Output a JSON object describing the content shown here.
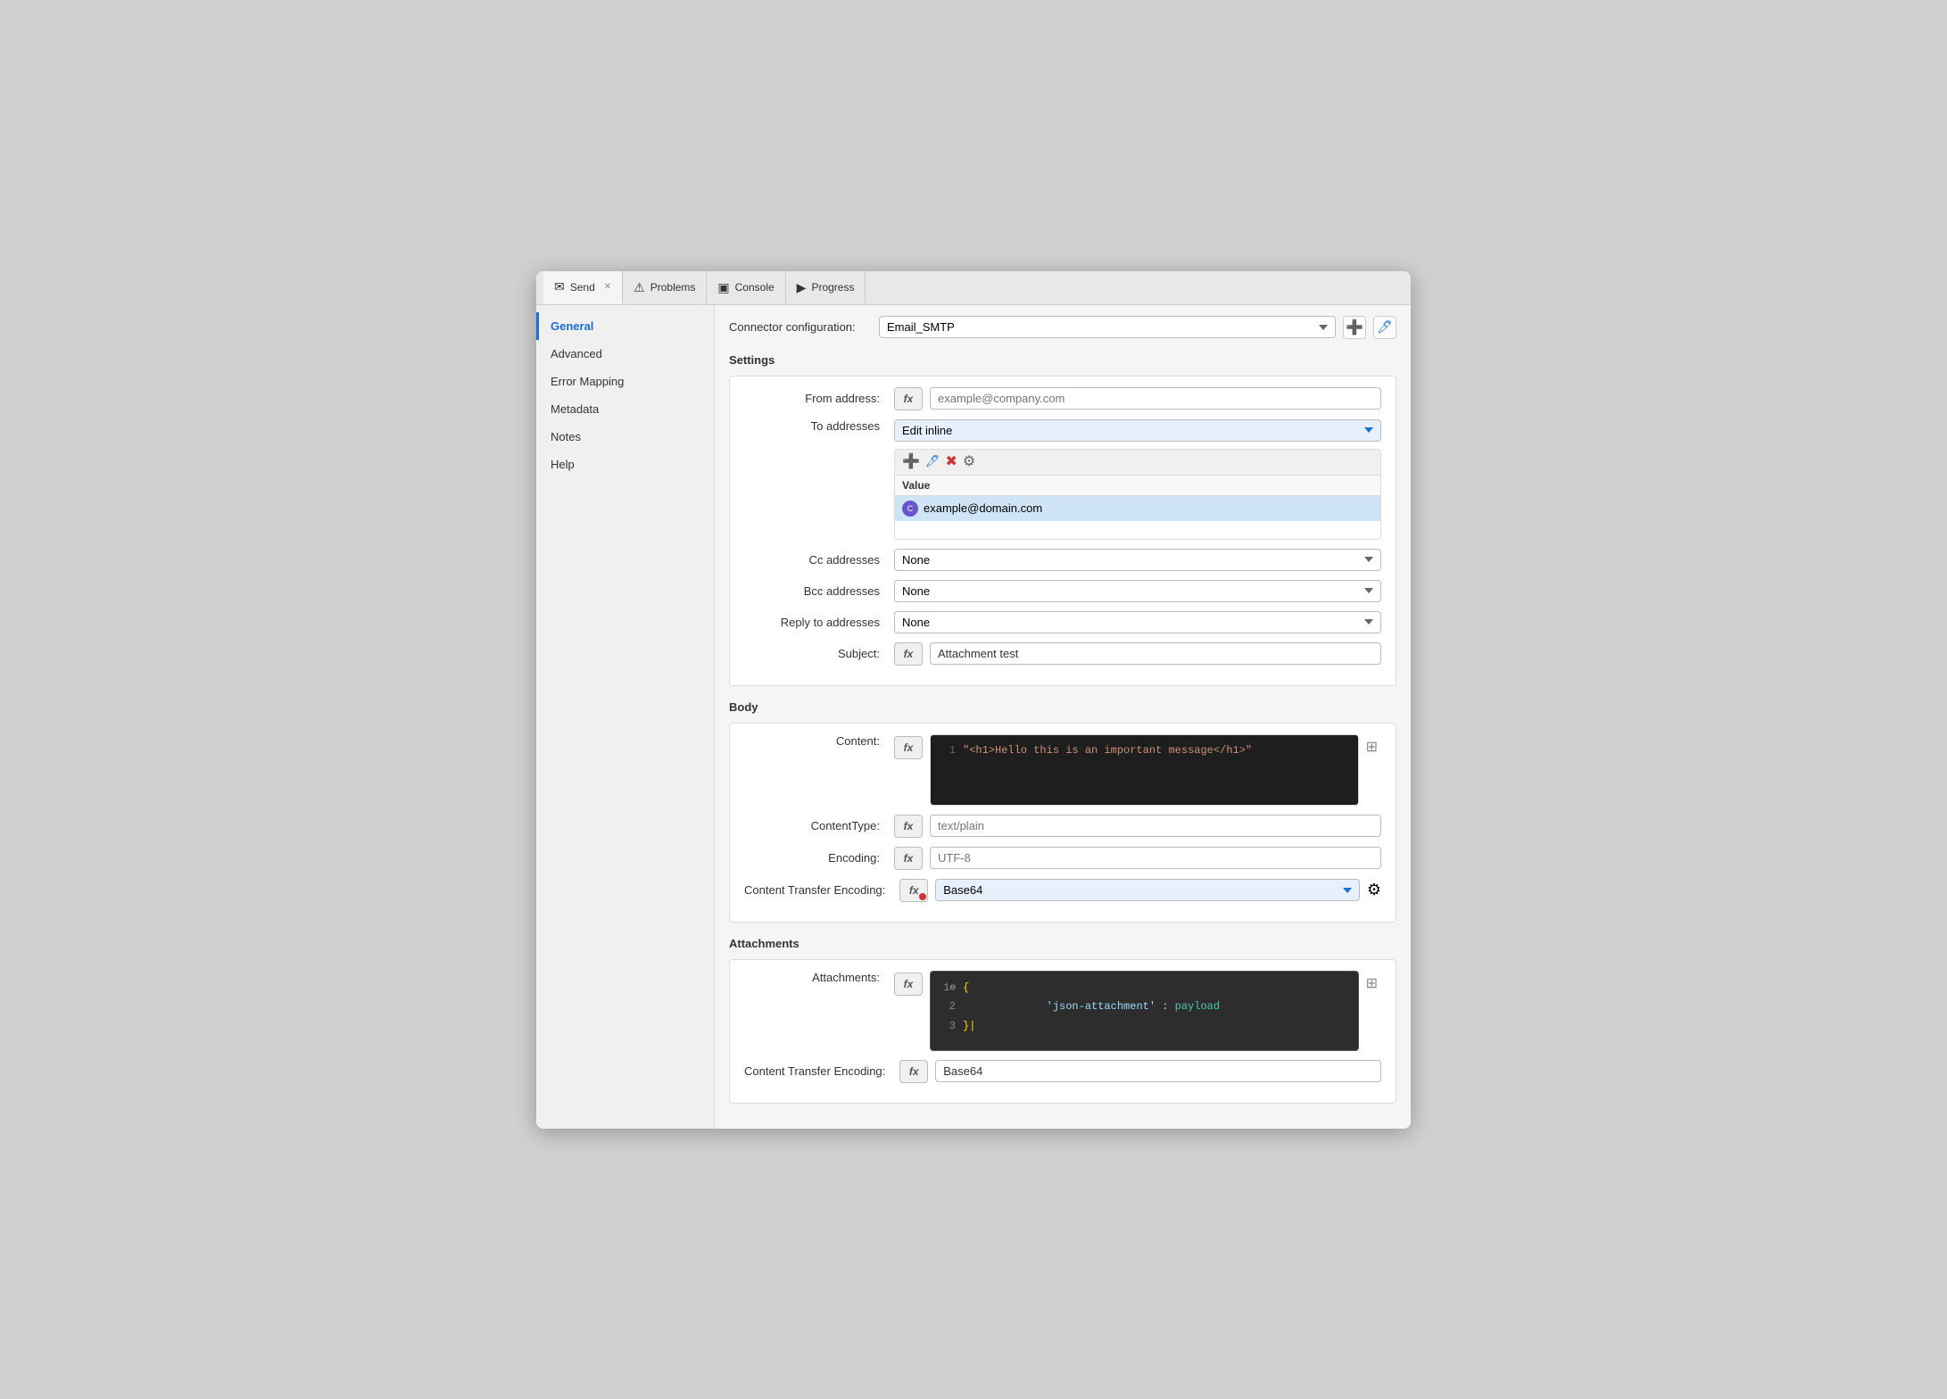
{
  "window": {
    "title": "Send"
  },
  "tabs": [
    {
      "id": "send",
      "label": "Send",
      "icon": "✉",
      "active": true,
      "closable": true
    },
    {
      "id": "problems",
      "label": "Problems",
      "icon": "⚠",
      "active": false,
      "closable": false
    },
    {
      "id": "console",
      "label": "Console",
      "icon": "▣",
      "active": false,
      "closable": false
    },
    {
      "id": "progress",
      "label": "Progress",
      "icon": "▶",
      "active": false,
      "closable": false
    }
  ],
  "sidebar": {
    "items": [
      {
        "id": "general",
        "label": "General",
        "active": true
      },
      {
        "id": "advanced",
        "label": "Advanced",
        "active": false
      },
      {
        "id": "error-mapping",
        "label": "Error Mapping",
        "active": false
      },
      {
        "id": "metadata",
        "label": "Metadata",
        "active": false
      },
      {
        "id": "notes",
        "label": "Notes",
        "active": false
      },
      {
        "id": "help",
        "label": "Help",
        "active": false
      }
    ]
  },
  "content": {
    "connector_config_label": "Connector configuration:",
    "connector_config_value": "Email_SMTP",
    "settings_section": "Settings",
    "from_address_label": "From address:",
    "from_address_placeholder": "example@company.com",
    "to_addresses_label": "To addresses",
    "to_addresses_value": "Edit inline",
    "toolbar": {
      "add": "➕",
      "edit": "🖊",
      "delete": "✖",
      "settings": "⚙"
    },
    "table_header": "Value",
    "email_entry": "example@domain.com",
    "cc_label": "Cc addresses",
    "cc_value": "None",
    "bcc_label": "Bcc addresses",
    "bcc_value": "None",
    "reply_to_label": "Reply to addresses",
    "reply_to_value": "None",
    "subject_label": "Subject:",
    "subject_value": "Attachment test",
    "body_section": "Body",
    "content_label": "Content:",
    "content_code": "\"<h1>Hello this is an important message</h1>\"",
    "content_line": "1",
    "content_type_label": "ContentType:",
    "content_type_placeholder": "text/plain",
    "encoding_label": "Encoding:",
    "encoding_placeholder": "UTF-8",
    "transfer_encoding_label": "Content Transfer Encoding:",
    "transfer_encoding_value": "Base64",
    "attachments_section": "Attachments",
    "attachments_label": "Attachments:",
    "attachments_line1": "1",
    "attachments_line2": "2",
    "attachments_line3": "3",
    "attachments_code_line1": "{",
    "attachments_code_line2_key": "'json-attachment'",
    "attachments_code_line2_colon": " : ",
    "attachments_code_line2_value": "payload",
    "attachments_code_line3": "}|",
    "attach_transfer_encoding_label": "Content Transfer Encoding:",
    "attach_transfer_encoding_value": "Base64"
  }
}
